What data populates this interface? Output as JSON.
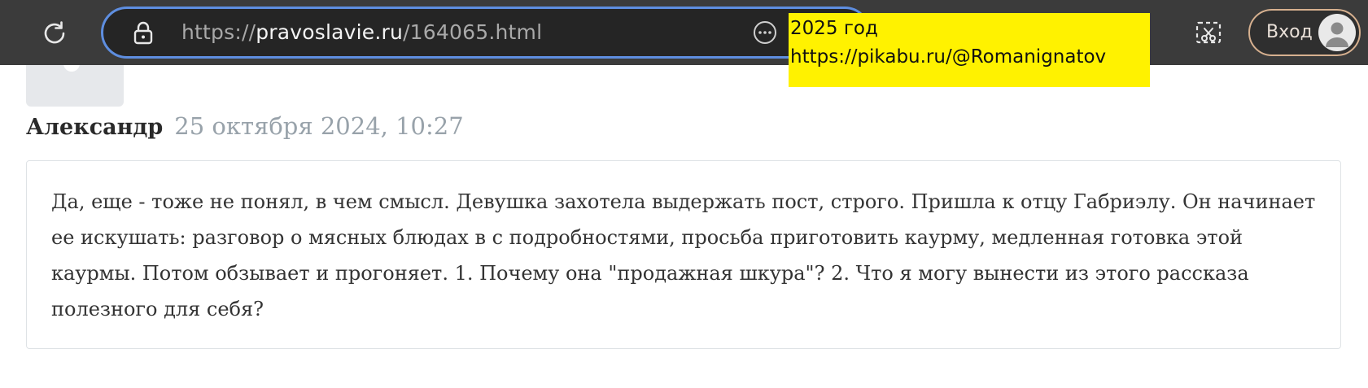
{
  "browser": {
    "url_scheme": "https://",
    "url_host": "pravoslavie.ru",
    "url_path": "/164065.html",
    "login_label": "Вход",
    "icons": {
      "reload": "reload-icon",
      "lock": "lock-icon",
      "more": "more-options-icon",
      "screenshot": "screenshot-icon",
      "profile": "profile-avatar-icon"
    },
    "colors": {
      "bar": "#3b3b3b",
      "address_border": "#5e8ee0",
      "login_border": "#d6b08f"
    }
  },
  "overlay_note": {
    "line1": "2025 год",
    "line2": "https://pikabu.ru/@Romanignatov",
    "color": "#fff200"
  },
  "comment": {
    "author": "Александр",
    "date": "25 октября 2024, 10:27",
    "text": "Да, еще - тоже не понял, в чем смысл. Девушка захотела выдержать пост, строго. Пришла к отцу Габриэлу. Он начинает ее искушать: разговор о мясных блюдах в с подробностями, просьба приготовить каурму, медленная готовка этой каурмы. Потом обзывает и прогоняет. 1. Почему она \"продажная шкура\"? 2. Что я могу вынести из этого рассказа полезного для себя?"
  }
}
